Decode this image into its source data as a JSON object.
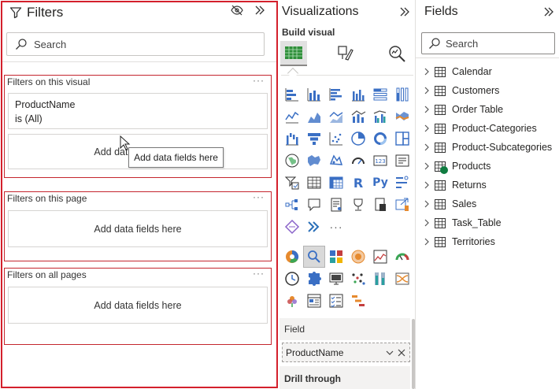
{
  "filters": {
    "title": "Filters",
    "search_placeholder": "Search",
    "sections": [
      {
        "title": "Filters on this visual",
        "more": "···",
        "field": {
          "name": "ProductName",
          "condition": "is (All)"
        },
        "drop_label": "Add data fields here",
        "tooltip": "Add data fields here"
      },
      {
        "title": "Filters on this page",
        "more": "···",
        "drop_label": "Add data fields here"
      },
      {
        "title": "Filters on all pages",
        "more": "···",
        "drop_label": "Add data fields here"
      }
    ]
  },
  "visualizations": {
    "title": "Visualizations",
    "build_label": "Build visual",
    "field_section_label": "Field",
    "field_value": "ProductName",
    "drill_label": "Drill through",
    "more_visuals": "···"
  },
  "fields": {
    "title": "Fields",
    "search_placeholder": "Search",
    "tables": [
      {
        "name": "Calendar",
        "icon": "table-icon"
      },
      {
        "name": "Customers",
        "icon": "table-icon"
      },
      {
        "name": "Order Table",
        "icon": "table-icon"
      },
      {
        "name": "Product-Categories",
        "icon": "table-icon"
      },
      {
        "name": "Product-Subcategories",
        "icon": "table-icon"
      },
      {
        "name": "Products",
        "icon": "table-icon",
        "status": "in-use"
      },
      {
        "name": "Returns",
        "icon": "table-icon"
      },
      {
        "name": "Sales",
        "icon": "table-icon"
      },
      {
        "name": "Task_Table",
        "icon": "table-icon"
      },
      {
        "name": "Territories",
        "icon": "table-icon"
      }
    ]
  },
  "colors": {
    "accent": "#118dff",
    "highlight_border": "#d4202c",
    "in_use_badge": "#107c41"
  }
}
